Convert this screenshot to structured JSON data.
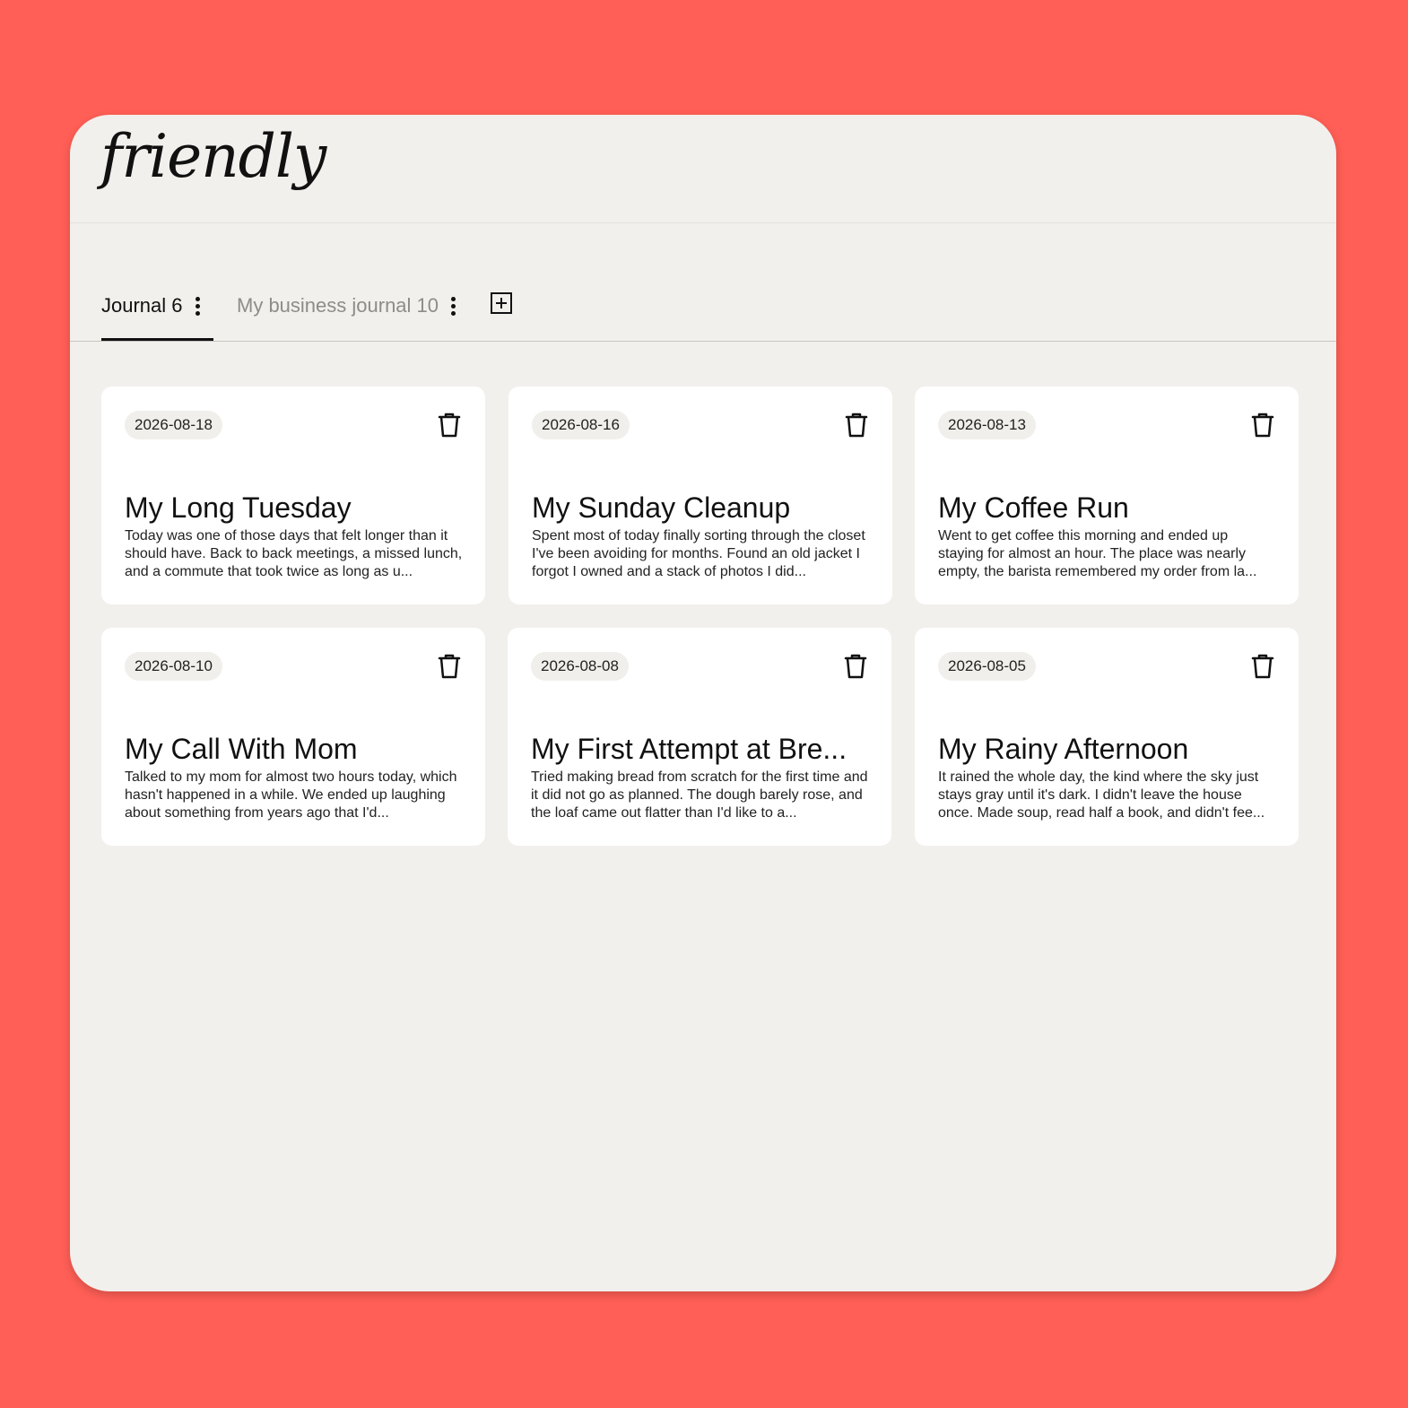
{
  "app": {
    "logo_text": "friendly"
  },
  "tabs": [
    {
      "label": "Journal 6",
      "active": true
    },
    {
      "label": "My business journal 10",
      "active": false
    }
  ],
  "entries": [
    {
      "date": "2026-08-18",
      "title": "My Long Tuesday",
      "excerpt": "Today was one of those days that felt longer than it should have. Back to back meetings, a missed lunch, and a commute that took twice as long as u..."
    },
    {
      "date": "2026-08-16",
      "title": "My Sunday Cleanup",
      "excerpt": "Spent most of today finally sorting through the closet I've been avoiding for months. Found an old jacket I forgot I owned and a stack of photos I did..."
    },
    {
      "date": "2026-08-13",
      "title": "My Coffee Run",
      "excerpt": "Went to get coffee this morning and ended up staying for almost an hour. The place was nearly empty, the barista remembered my order from la..."
    },
    {
      "date": "2026-08-10",
      "title": "My Call With Mom",
      "excerpt": "Talked to my mom for almost two hours today, which hasn't happened in a while. We ended up laughing about something from years ago that I'd..."
    },
    {
      "date": "2026-08-08",
      "title": "My First Attempt at Bre...",
      "excerpt": "Tried making bread from scratch for the first time and it did not go as planned. The dough barely rose, and the loaf came out flatter than I'd like to a..."
    },
    {
      "date": "2026-08-05",
      "title": "My Rainy Afternoon",
      "excerpt": "It rained the whole day, the kind where the sky just stays gray until it's dark. I didn't leave the house once. Made soup, read half a book, and didn't fee..."
    }
  ],
  "colors": {
    "background": "#ff5f56",
    "window": "#f2f0ec",
    "card": "#ffffff",
    "chip": "#f1efeb",
    "text": "#111111",
    "inactive_tab_text": "#8f8c87"
  },
  "icons": {
    "tab_menu": "kebab-vertical-icon",
    "add_tab": "plus-square-icon",
    "delete_entry": "trash-icon"
  }
}
